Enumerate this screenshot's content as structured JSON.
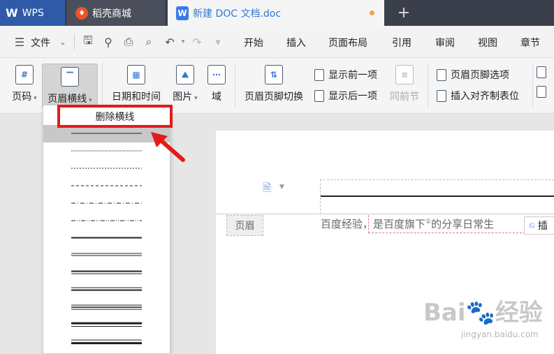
{
  "tabs": {
    "wps": "WPS",
    "daoke": "稻壳商城",
    "doc": "新建 DOC 文档.doc",
    "new_tab": "+"
  },
  "menubar": {
    "file": "文件",
    "items": [
      "开始",
      "插入",
      "页面布局",
      "引用",
      "审阅",
      "视图",
      "章节"
    ]
  },
  "ribbon": {
    "page_number": "页码",
    "header_line": "页眉横线",
    "date_time": "日期和时间",
    "picture": "图片",
    "field": "域",
    "switch_header_footer": "页眉页脚切换",
    "show_prev": "显示前一项",
    "show_next": "显示后一项",
    "same_as_prev": "同前节",
    "header_footer_options": "页眉页脚选项",
    "insert_align_tab": "插入对齐制表位"
  },
  "dropdown": {
    "delete_line": "删除横线"
  },
  "document": {
    "header_tag": "页眉",
    "body_text": "百度经验，是百度旗下",
    "footnote_mark": "①",
    "body_text_tail": "的分享日常生",
    "insert_chip": "插"
  },
  "watermark": {
    "main": "Bai🐾经验",
    "sub": "jingyan.baidu.com"
  },
  "colors": {
    "tab_active_wps": "#2f5aa8",
    "highlight_red": "#e41a1a",
    "accent_blue": "#2d7ad6"
  }
}
